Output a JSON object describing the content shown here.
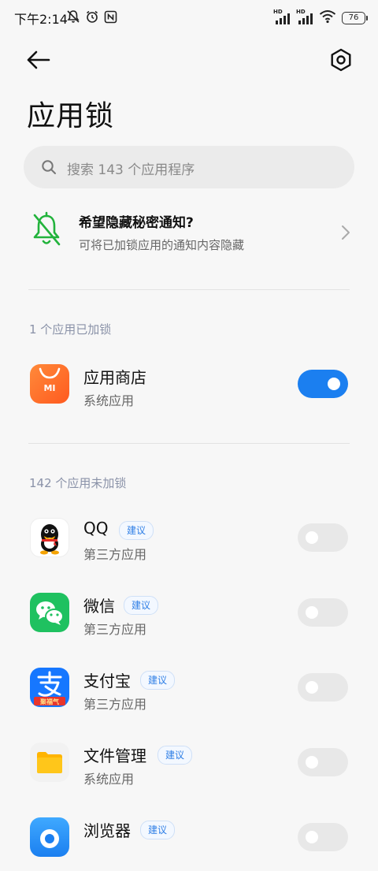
{
  "status": {
    "time": "下午2:14",
    "hd1": "HD",
    "hd2": "HD",
    "battery": "76"
  },
  "header": {
    "title": "应用锁"
  },
  "search": {
    "placeholder": "搜索 143 个应用程序"
  },
  "notice": {
    "title": "希望隐藏秘密通知?",
    "subtitle": "可将已加锁应用的通知内容隐藏"
  },
  "locked": {
    "label": "1 个应用已加锁",
    "apps": [
      {
        "name": "应用商店",
        "type": "系统应用",
        "locked": true,
        "icon": "mi-store-icon",
        "icon_text": "MI"
      }
    ]
  },
  "unlocked": {
    "label": "142 个应用未加锁",
    "apps": [
      {
        "name": "QQ",
        "type": "第三方应用",
        "badge": "建议",
        "locked": false,
        "icon": "qq-icon"
      },
      {
        "name": "微信",
        "type": "第三方应用",
        "badge": "建议",
        "locked": false,
        "icon": "wechat-icon"
      },
      {
        "name": "支付宝",
        "type": "第三方应用",
        "badge": "建议",
        "locked": false,
        "icon": "alipay-icon",
        "icon_text": "聚福气"
      },
      {
        "name": "文件管理",
        "type": "系统应用",
        "badge": "建议",
        "locked": false,
        "icon": "file-manager-icon"
      },
      {
        "name": "浏览器",
        "type": "",
        "badge": "建议",
        "locked": false,
        "icon": "browser-icon"
      }
    ]
  },
  "colors": {
    "accent": "#1b7ff0",
    "notice_icon": "#22b33c",
    "section_label": "#8a92a8"
  }
}
